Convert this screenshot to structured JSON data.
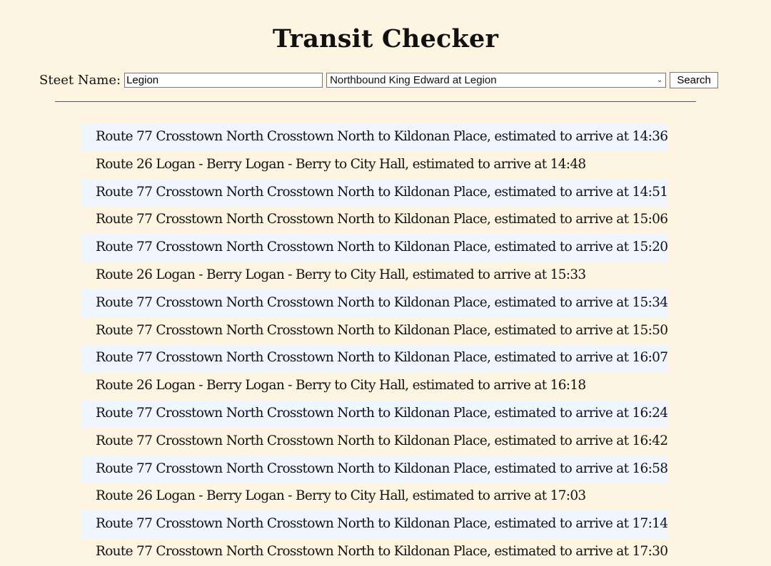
{
  "page": {
    "title": "Transit Checker"
  },
  "search": {
    "label": "Steet Name:",
    "street_value": "Legion",
    "stop_selected": "Northbound King Edward at Legion",
    "button_label": "Search"
  },
  "colors": {
    "background": "#fdf5e2",
    "row_highlight": "#eff6ff"
  },
  "results": [
    "Route 77 Crosstown North Crosstown North to Kildonan Place, estimated to arrive at 14:36",
    "Route 26 Logan - Berry Logan - Berry to City Hall, estimated to arrive at 14:48",
    "Route 77 Crosstown North Crosstown North to Kildonan Place, estimated to arrive at 14:51",
    "Route 77 Crosstown North Crosstown North to Kildonan Place, estimated to arrive at 15:06",
    "Route 77 Crosstown North Crosstown North to Kildonan Place, estimated to arrive at 15:20",
    "Route 26 Logan - Berry Logan - Berry to City Hall, estimated to arrive at 15:33",
    "Route 77 Crosstown North Crosstown North to Kildonan Place, estimated to arrive at 15:34",
    "Route 77 Crosstown North Crosstown North to Kildonan Place, estimated to arrive at 15:50",
    "Route 77 Crosstown North Crosstown North to Kildonan Place, estimated to arrive at 16:07",
    "Route 26 Logan - Berry Logan - Berry to City Hall, estimated to arrive at 16:18",
    "Route 77 Crosstown North Crosstown North to Kildonan Place, estimated to arrive at 16:24",
    "Route 77 Crosstown North Crosstown North to Kildonan Place, estimated to arrive at 16:42",
    "Route 77 Crosstown North Crosstown North to Kildonan Place, estimated to arrive at 16:58",
    "Route 26 Logan - Berry Logan - Berry to City Hall, estimated to arrive at 17:03",
    "Route 77 Crosstown North Crosstown North to Kildonan Place, estimated to arrive at 17:14",
    "Route 77 Crosstown North Crosstown North to Kildonan Place, estimated to arrive at 17:30"
  ]
}
